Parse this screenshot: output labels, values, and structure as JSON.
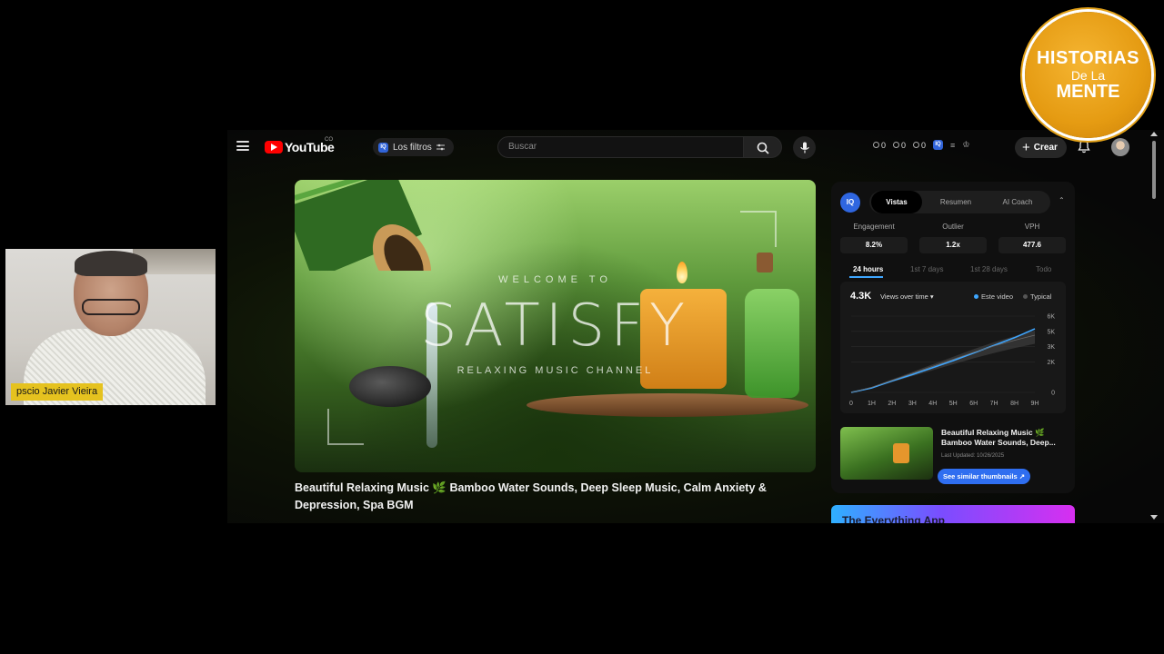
{
  "topbar": {
    "brand": "YouTube",
    "country_code": "CO",
    "filters_label": "Los filtros",
    "filters_badge": "IQ",
    "search_placeholder": "Buscar",
    "stats": [
      "0",
      "0",
      "0"
    ],
    "create_label": "Crear"
  },
  "video": {
    "overlay_welcome": "WELCOME TO",
    "overlay_title": "SATISFY",
    "overlay_subtitle": "RELAXING MUSIC CHANNEL",
    "title": "Beautiful Relaxing Music 🌿 Bamboo Water Sounds, Deep Sleep Music, Calm Anxiety & Depression, Spa BGM"
  },
  "panel": {
    "badge": "IQ",
    "tabs": [
      {
        "label": "Vistas",
        "active": true
      },
      {
        "label": "Resumen",
        "active": false
      },
      {
        "label": "AI Coach",
        "active": false
      }
    ],
    "metrics": [
      {
        "label": "Engagement",
        "value": "8.2%"
      },
      {
        "label": "Outlier",
        "value": "1.2x"
      },
      {
        "label": "VPH",
        "value": "477.6"
      }
    ],
    "time_tabs": [
      {
        "label": "24 hours",
        "active": true
      },
      {
        "label": "1st 7 days",
        "active": false
      },
      {
        "label": "1st 28 days",
        "active": false
      },
      {
        "label": "Todo",
        "active": false
      }
    ],
    "chart_total": "4.3K",
    "chart_selector": "Views over time",
    "legend": [
      {
        "name": "Este video",
        "color": "#3ea6ff"
      },
      {
        "name": "Typical",
        "color": "#555555"
      }
    ],
    "related": {
      "title": "Beautiful Relaxing Music 🌿 Bamboo Water Sounds, Deep...",
      "updated": "Last Updated: 10/26/2025",
      "button": "See similar thumbnails"
    },
    "promo_text": "The Everything App"
  },
  "chart_data": {
    "type": "line",
    "x": [
      "0",
      "1H",
      "2H",
      "3H",
      "4H",
      "5H",
      "6H",
      "7H",
      "8H",
      "9H"
    ],
    "series": [
      {
        "name": "Este video",
        "values": [
          0,
          350,
          900,
          1400,
          1950,
          2500,
          3100,
          3700,
          4300,
          5000
        ]
      },
      {
        "name": "Typical",
        "values": [
          0,
          400,
          950,
          1500,
          2050,
          2600,
          3150,
          3650,
          4100,
          4500
        ]
      }
    ],
    "yticks": [
      "6K",
      "5K",
      "3K",
      "2K",
      "0"
    ],
    "ylim": [
      0,
      6000
    ]
  },
  "webcam": {
    "label": "pscio Javier Vieira"
  },
  "logo": {
    "line1": "HISTORIAS",
    "line2": "De La",
    "line3": "MENTE"
  },
  "colors": {
    "accent_blue": "#3ea6ff",
    "button_blue": "#2f6ef0",
    "logo_orange": "#e59b12",
    "webcam_label": "#e5c21f"
  }
}
